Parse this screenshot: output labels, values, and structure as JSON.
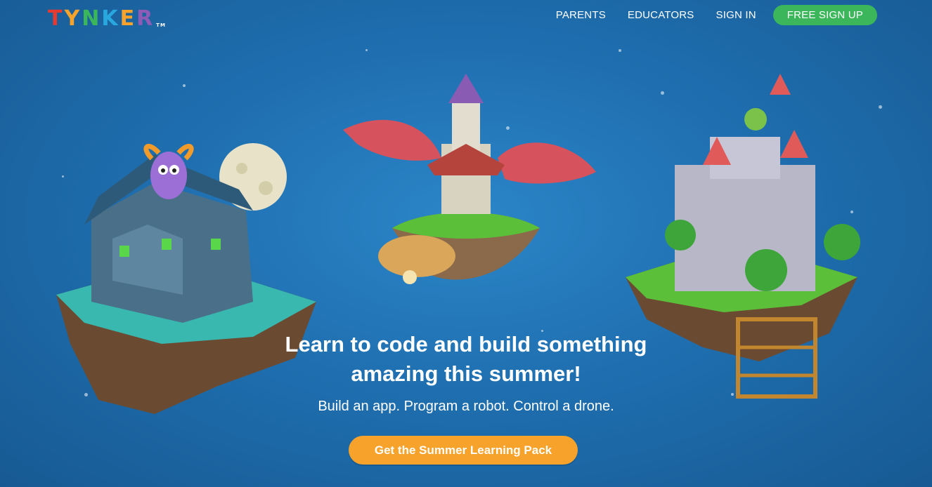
{
  "brand": {
    "logo_letters": [
      "T",
      "Y",
      "N",
      "K",
      "E",
      "R"
    ],
    "logo_colors": [
      "#e53a2f",
      "#f6a22b",
      "#3cb65a",
      "#29a8e0",
      "#f6a22b",
      "#8e5bb7"
    ],
    "trademark": "TM"
  },
  "nav": {
    "parents": "PARENTS",
    "educators": "EDUCATORS",
    "sign_in": "SIGN IN",
    "free_sign_up": "FREE SIGN UP"
  },
  "hero": {
    "headline_line1": "Learn to code and build something",
    "headline_line2": "amazing this summer!",
    "subhead": "Build an app. Program a robot. Control a drone.",
    "cta_label": "Get the Summer Learning Pack"
  },
  "colors": {
    "background": "#1f6fb0",
    "signup_button": "#3cb65a",
    "cta_button": "#f6a22b"
  }
}
